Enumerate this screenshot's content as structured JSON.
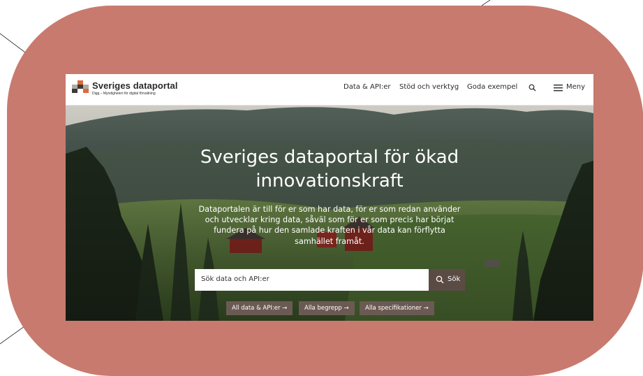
{
  "header": {
    "brand_title": "Sveriges dataportal",
    "brand_subtitle": "Digg – Myndigheten för digital förvaltning",
    "nav": [
      {
        "label": "Data & API:er"
      },
      {
        "label": "Stöd och verktyg"
      },
      {
        "label": "Goda exempel"
      }
    ],
    "search_icon": "search-icon",
    "menu_icon": "hamburger-menu-icon",
    "menu_label": "Meny"
  },
  "hero": {
    "title_line1": "Sveriges dataportal för ökad",
    "title_line2": "innovationskraft",
    "text_line1": "Dataportalen är till för er som har data, för er som redan använder",
    "text_line2": "och utvecklar kring data, såväl som för er som precis har börjat",
    "text_line3": "fundera på hur den samlade kraften i vår data kan förflytta",
    "text_line4": "samhället framåt."
  },
  "search": {
    "placeholder": "Sök data och API:er",
    "button_label": "Sök"
  },
  "chips": [
    {
      "label": "All data & API:er →"
    },
    {
      "label": "Alla begrepp →"
    },
    {
      "label": "Alla specifikationer →"
    }
  ],
  "colors": {
    "backdrop": "#c97a6e",
    "search_button": "#5b4b45",
    "chip": "#6b5a53",
    "logo_orange": "#e0693a",
    "logo_dark": "#3d3937",
    "logo_grey": "#b0aaa6"
  }
}
